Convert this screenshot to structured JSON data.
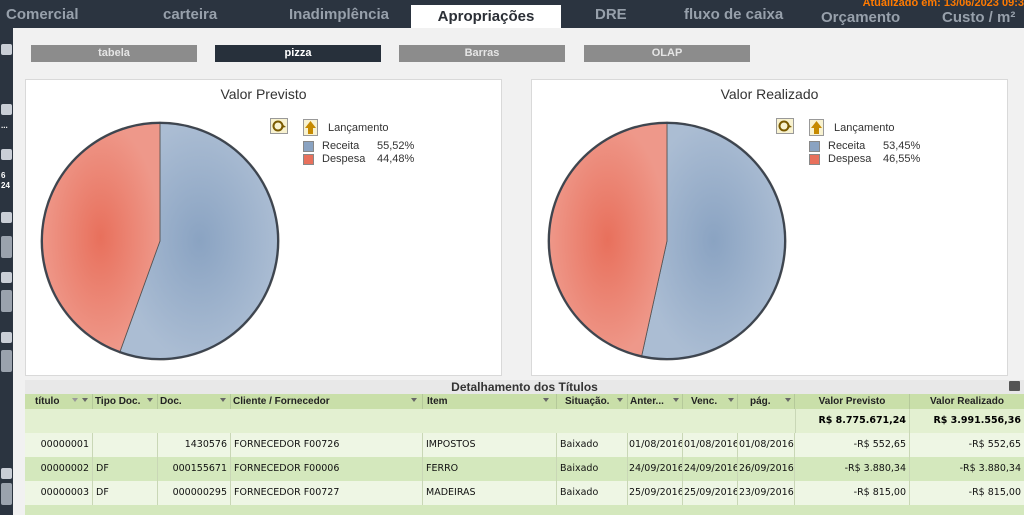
{
  "nav": {
    "tabs": [
      {
        "label": "Comercial"
      },
      {
        "label": "carteira"
      },
      {
        "label": "Inadimplência"
      },
      {
        "label": "Apropriações"
      },
      {
        "label": "DRE"
      },
      {
        "label": "fluxo de caixa"
      },
      {
        "label": "Orçamento"
      },
      {
        "label": "Custo / m²"
      }
    ],
    "updated": "Atualizado em: 13/06/2023 09:3"
  },
  "left_strip": {
    "t1": "...",
    "t2": "6",
    "t3": "24"
  },
  "subtabs": [
    {
      "label": "tabela"
    },
    {
      "label": "pizza"
    },
    {
      "label": "Barras"
    },
    {
      "label": "OLAP"
    }
  ],
  "charts": {
    "previsto": {
      "title": "Valor Previsto",
      "legend_title": "Lançamento"
    },
    "realizado": {
      "title": "Valor Realizado",
      "legend_title": "Lançamento"
    }
  },
  "chart_data": [
    {
      "type": "pie",
      "title": "Valor Previsto",
      "legend_title": "Lançamento",
      "series": [
        {
          "name": "Receita",
          "value": 55.52,
          "label": "55,52%",
          "color": "#8aa3c2"
        },
        {
          "name": "Despesa",
          "value": 44.48,
          "label": "44,48%",
          "color": "#e8705c"
        }
      ]
    },
    {
      "type": "pie",
      "title": "Valor Realizado",
      "legend_title": "Lançamento",
      "series": [
        {
          "name": "Receita",
          "value": 53.45,
          "label": "53,45%",
          "color": "#8aa3c2"
        },
        {
          "name": "Despesa",
          "value": 46.55,
          "label": "46,55%",
          "color": "#e8705c"
        }
      ]
    }
  ],
  "grid": {
    "title": "Detalhamento dos Títulos",
    "columns": [
      "título",
      "Tipo Doc.",
      "Doc.",
      "Cliente / Fornecedor",
      "Item",
      "Situação.",
      "Anter...",
      "Venc.",
      "pág.",
      "Valor Previsto",
      "Valor Realizado"
    ],
    "totals": {
      "previsto": "R$ 8.775.671,24",
      "realizado": "R$ 3.991.556,36"
    },
    "rows": [
      {
        "titulo": "00000001",
        "tipo": "",
        "doc": "1430576",
        "cliente": "FORNECEDOR F00726",
        "item": "IMPOSTOS",
        "situacao": "Baixado",
        "anter": "01/08/2016",
        "venc": "01/08/2016",
        "pag": "01/08/2016",
        "previsto": "-R$ 552,65",
        "realizado": "-R$ 552,65"
      },
      {
        "titulo": "00000002",
        "tipo": "DF",
        "doc": "000155671",
        "cliente": "FORNECEDOR F00006",
        "item": "FERRO",
        "situacao": "Baixado",
        "anter": "24/09/2016",
        "venc": "24/09/2016",
        "pag": "26/09/2016",
        "previsto": "-R$ 3.880,34",
        "realizado": "-R$ 3.880,34"
      },
      {
        "titulo": "00000003",
        "tipo": "DF",
        "doc": "000000295",
        "cliente": "FORNECEDOR F00727",
        "item": "MADEIRAS",
        "situacao": "Baixado",
        "anter": "25/09/2016",
        "venc": "25/09/2016",
        "pag": "23/09/2016",
        "previsto": "-R$ 815,00",
        "realizado": "-R$ 815,00"
      }
    ]
  },
  "colors": {
    "nav_bg": "#2b3440",
    "receita": "#8aa3c2",
    "despesa": "#e8705c",
    "header_green": "#c9dfa9",
    "row_green": "#d4e8bd",
    "updated_orange": "#ff7a00"
  }
}
